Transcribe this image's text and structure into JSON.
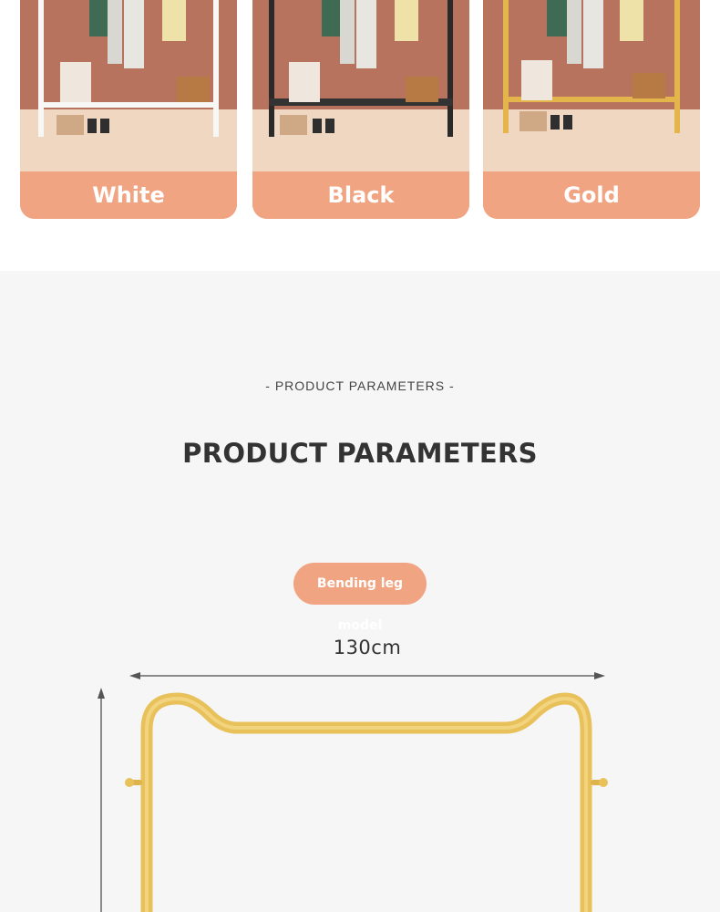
{
  "variants": [
    {
      "label": "White"
    },
    {
      "label": "Black"
    },
    {
      "label": "Gold"
    }
  ],
  "section": {
    "subtitle": "- PRODUCT PARAMETERS -",
    "title": "PRODUCT PARAMETERS",
    "model_label": "Bending leg model",
    "width_label": "130cm"
  },
  "colors": {
    "accent": "#f0a482",
    "rack_gold": "#e9c15a",
    "background": "#f6f6f6"
  }
}
